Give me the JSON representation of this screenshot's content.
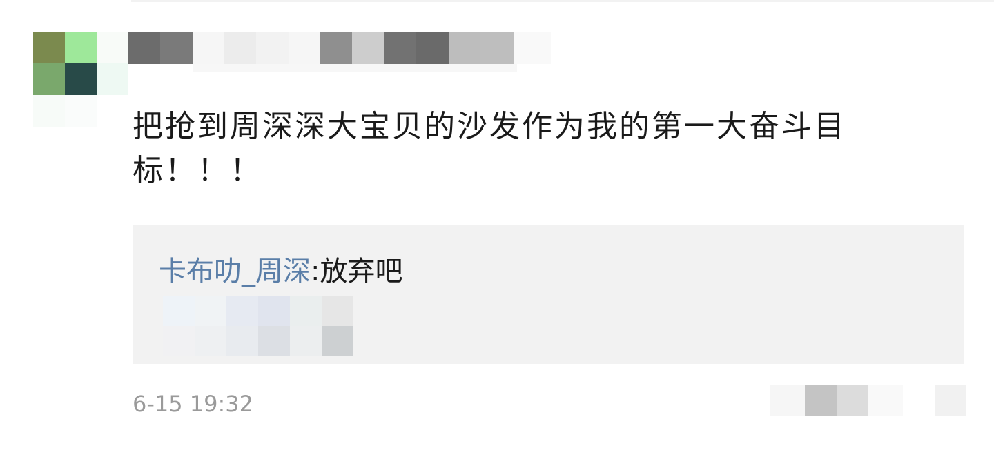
{
  "comment": {
    "author_name": "",
    "text": "把抢到周深深大宝贝的沙发作为我的第一大奋斗目标！！！",
    "timestamp": "6-15 19:32"
  },
  "reply": {
    "author": "卡布叻_周深",
    "separator": ":",
    "text": "放弃吧"
  },
  "colors": {
    "author_link": "#5a7ea8",
    "reply_background": "#f2f2f2",
    "timestamp": "#9a9a9a",
    "text": "#1a1a1a"
  },
  "icons": {
    "avatar": "avatar-image",
    "actions": [
      "more-icon",
      "like-icon"
    ]
  }
}
